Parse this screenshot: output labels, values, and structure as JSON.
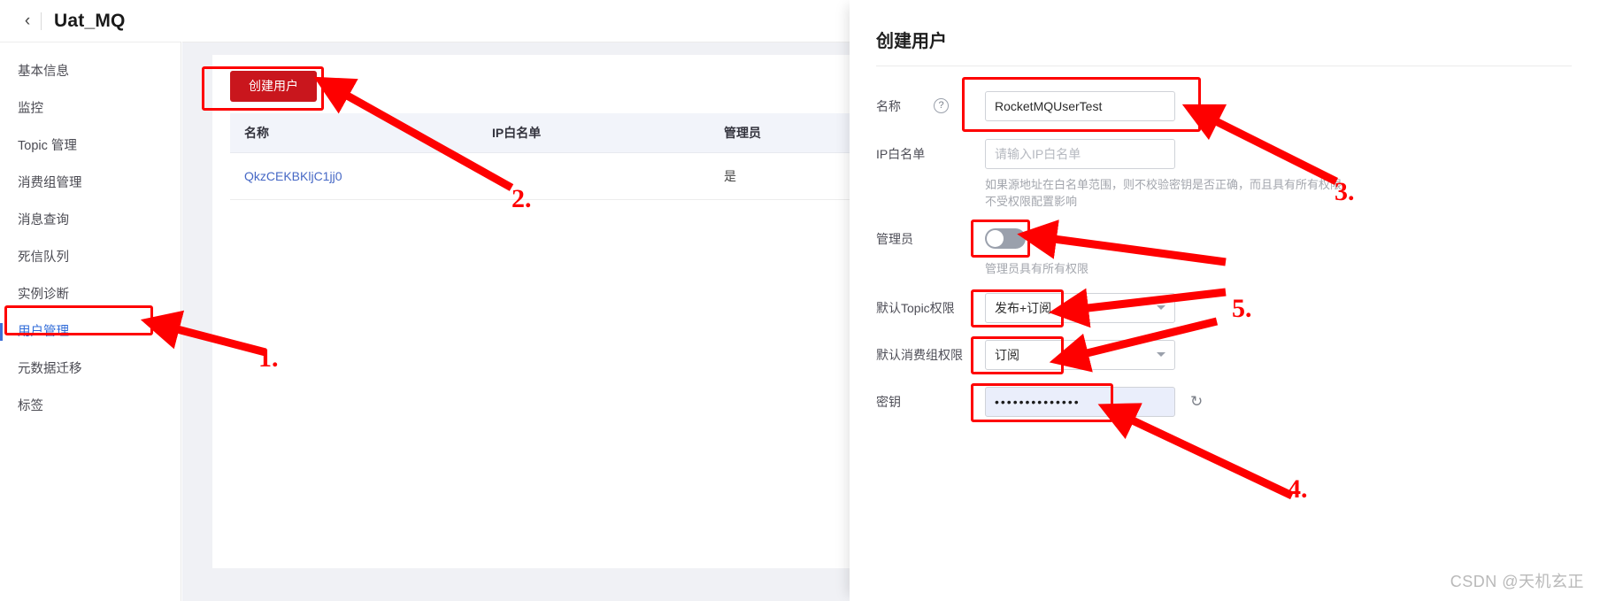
{
  "header": {
    "back_icon": "chevron-left-icon",
    "title": "Uat_MQ"
  },
  "sidebar": {
    "items": [
      {
        "label": "基本信息",
        "active": false
      },
      {
        "label": "监控",
        "active": false
      },
      {
        "label": "Topic 管理",
        "active": false
      },
      {
        "label": "消费组管理",
        "active": false
      },
      {
        "label": "消息查询",
        "active": false
      },
      {
        "label": "死信队列",
        "active": false
      },
      {
        "label": "实例诊断",
        "active": false
      },
      {
        "label": "用户管理",
        "active": true
      },
      {
        "label": "元数据迁移",
        "active": false
      },
      {
        "label": "标签",
        "active": false
      }
    ]
  },
  "main": {
    "create_user_button": "创建用户",
    "table": {
      "columns": [
        "名称",
        "IP白名单",
        "管理员"
      ],
      "rows": [
        {
          "name": "QkzCEKBKljC1jj0",
          "ip_whitelist": "",
          "admin": "是"
        }
      ]
    }
  },
  "drawer": {
    "title": "创建用户",
    "fields": {
      "name": {
        "label": "名称",
        "help_icon": "question-mark-icon",
        "value": "RocketMQUserTest"
      },
      "ip_whitelist": {
        "label": "IP白名单",
        "value": "",
        "placeholder": "请输入IP白名单",
        "help": "如果源地址在白名单范围，则不校验密钥是否正确，而且具有所有权限，不受权限配置影响"
      },
      "admin": {
        "label": "管理员",
        "toggle_state": "off",
        "help": "管理员具有所有权限"
      },
      "default_topic_permission": {
        "label": "默认Topic权限",
        "value": "发布+订阅",
        "caret_icon": "chevron-down-icon"
      },
      "default_group_permission": {
        "label": "默认消费组权限",
        "value": "订阅",
        "caret_icon": "chevron-down-icon"
      },
      "secret": {
        "label": "密钥",
        "value": "••••••••••••••",
        "refresh_icon": "refresh-icon"
      }
    }
  },
  "annotations": {
    "numbers": [
      "1.",
      "2.",
      "3.",
      "5.",
      "4."
    ],
    "color": "#fe0000"
  },
  "watermark": "CSDN @天机玄正"
}
